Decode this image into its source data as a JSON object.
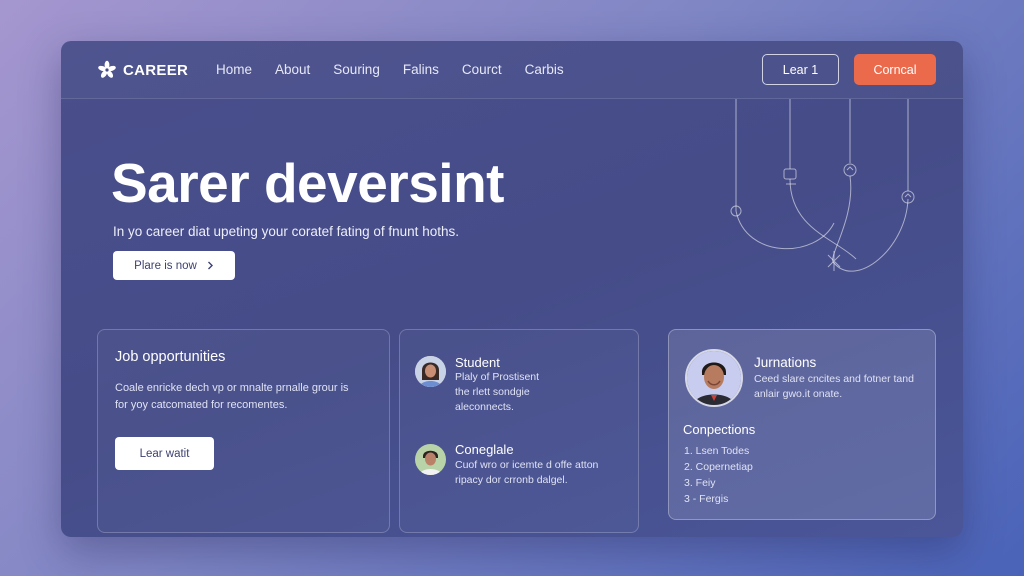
{
  "brand": {
    "name": "CAREER",
    "icon": "flower-logo-icon"
  },
  "nav": [
    "Home",
    "About",
    "Souring",
    "Falins",
    "Courct",
    "Carbis"
  ],
  "header_buttons": {
    "outline": "Lear 1",
    "primary": "Corncal"
  },
  "hero": {
    "title": "Sarer deversint",
    "subtitle": "In yo career diat upeting your coratef fating of fnunt hoths.",
    "button": "Plare is now",
    "button_icon": "chevron-right-icon"
  },
  "job_card": {
    "title": "Job opportunities",
    "text_lines": [
      "Coale enricke dech vp or mnalte prnalle grour is",
      "for yoy catcomated for recomentes."
    ],
    "button": "Lear watit"
  },
  "people_card": {
    "people": [
      {
        "name": "Student",
        "lines": [
          "Plaly of Prostisent",
          "the rlett sondgie",
          "aleconnects."
        ]
      },
      {
        "name": "Coneglale",
        "lines": [
          "Cuof wro or icemte d offe atton",
          "ripacy dor crronb dalgel."
        ]
      }
    ]
  },
  "profile_card": {
    "name": "Jurnations",
    "lines": [
      "Ceed slare cncites and fotner tand",
      "anlair gwo.it onate."
    ],
    "section_title": "Conpections",
    "list": [
      "1. Lsen Todes",
      "2. Copernetiap",
      "3. Feiy",
      "3 - Fergis"
    ]
  },
  "colors": {
    "accent": "#ec6a4c",
    "window": "#464c89",
    "card_text": "#dfe2f4"
  }
}
